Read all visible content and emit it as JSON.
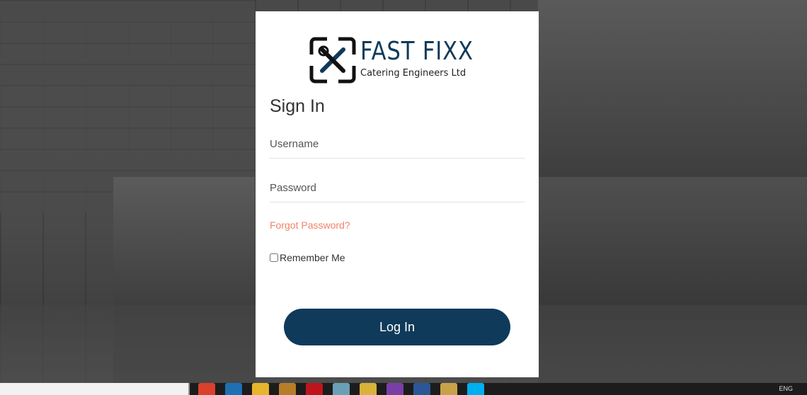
{
  "brand": {
    "name": "FAST FIXX",
    "tagline": "Catering Engineers Ltd",
    "logo_icon": "tools-cross-icon",
    "color": "#0f3a5a"
  },
  "form": {
    "heading": "Sign In",
    "username_placeholder": "Username",
    "password_placeholder": "Password",
    "forgot_link": "Forgot Password?",
    "remember_label": "Remember Me",
    "login_button": "Log In"
  },
  "colors": {
    "primary": "#0f3a5a",
    "link": "#f0836a",
    "card_bg": "#ffffff"
  },
  "taskbar": {
    "search_text": "",
    "tray_text": "ENG"
  }
}
